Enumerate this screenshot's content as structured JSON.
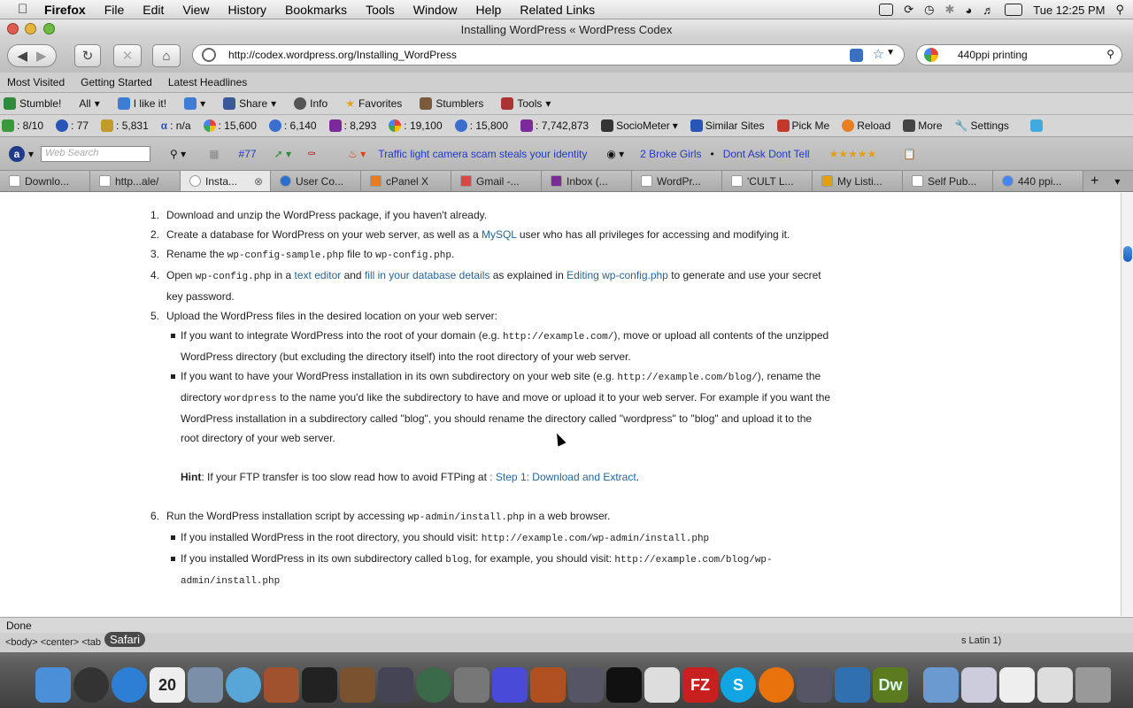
{
  "menubar": {
    "app": "Firefox",
    "items": [
      "File",
      "Edit",
      "View",
      "History",
      "Bookmarks",
      "Tools",
      "Window",
      "Help",
      "Related Links"
    ],
    "clock": "Tue 12:25 PM"
  },
  "window": {
    "title": "Installing WordPress « WordPress Codex"
  },
  "nav": {
    "url": "http://codex.wordpress.org/Installing_WordPress",
    "search_value": "440ppi printing"
  },
  "bookmarks": {
    "items": [
      "Most Visited",
      "Getting Started",
      "Latest Headlines"
    ]
  },
  "stumble": {
    "items": [
      "Stumble!",
      "All",
      "I like it!",
      "Share",
      "Info",
      "Favorites",
      "Stumblers",
      "Tools"
    ]
  },
  "stats": {
    "items": [
      ": 8/10",
      ": 77",
      ": 5,831",
      ": n/a",
      ": 15,600",
      ": 6,140",
      ": 8,293",
      ": 19,100",
      ": 15,800",
      ": 7,742,873",
      "SocioMeter",
      "Similar Sites",
      "Pick Me",
      "Reload",
      "More",
      "Settings"
    ]
  },
  "alexa": {
    "search_placeholder": "Web Search",
    "rank": "#77",
    "headline": "Traffic light camera scam steals your identity",
    "link1": "2 Broke Girls",
    "sep": "•",
    "link2": "Dont Ask Dont Tell",
    "stars": "★★★★★"
  },
  "tabs": [
    "Downlo...",
    "http...ale/",
    "Insta...",
    "User Co...",
    "cPanel X",
    "Gmail -...",
    "Inbox (...",
    "WordPr...",
    "'CULT L...",
    "My Listi...",
    "Self Pub...",
    "440 ppi..."
  ],
  "content": {
    "s1": "Download and unzip the WordPress package, if you haven't already.",
    "s2a": "Create a database for WordPress on your web server, as well as a ",
    "s2link": "MySQL",
    "s2b": " user who has all privileges for accessing and modifying it.",
    "s3a": "Rename the ",
    "s3c1": "wp-config-sample.php",
    "s3b": " file to ",
    "s3c2": "wp-config.php",
    "s3d": ".",
    "s4a": "Open ",
    "s4c": "wp-config.php",
    "s4b": " in a ",
    "s4l1": "text editor",
    "s4and": " and ",
    "s4l2": "fill in your database details",
    "s4c2": " as explained in ",
    "s4l3": "Editing wp-config.php",
    "s4d": " to generate and use your secret key password.",
    "s5": "Upload the WordPress files in the desired location on your web server:",
    "s5b1a": "If you want to integrate WordPress into the root of your domain (e.g. ",
    "s5b1c": "http://example.com/",
    "s5b1b": "), move or upload all contents of the unzipped WordPress directory (but excluding the directory itself) into the root directory of your web server.",
    "s5b2a": "If you want to have your WordPress installation in its own subdirectory on your web site (e.g. ",
    "s5b2c": "http://example.com/blog/",
    "s5b2b": "), rename the directory ",
    "s5b2c2": "wordpress",
    "s5b2d": " to the name you'd like the subdirectory to have and move or upload it to your web server. For example if you want the WordPress installation in a subdirectory called \"blog\", you should rename the directory called \"wordpress\" to \"blog\" and upload it to the root directory of your web server.",
    "hint_label": "Hint",
    "hint_text": ": If your FTP transfer is too slow read how to avoid FTPing at ",
    "hint_link": ": Step 1: Download and Extract",
    "hint_end": ".",
    "s6a": "Run the WordPress installation script by accessing ",
    "s6c": "wp-admin/install.php",
    "s6b": " in a web browser.",
    "s6b1a": "If you installed WordPress in the root directory, you should visit: ",
    "s6b1c": "http://example.com/wp-admin/install.php",
    "s6b2a": "If you installed WordPress in its own subdirectory called ",
    "s6b2c": "blog",
    "s6b2b": ", for example, you should visit: ",
    "s6b2c2": "http://example.com/blog/wp-admin/install.php"
  },
  "status": {
    "text": "Done"
  },
  "devbar": {
    "text": "<body> <center> <tab",
    "tooltip": "Safari",
    "right": "s Latin 1)"
  },
  "colors": {
    "link": "#2a6496",
    "chrome": "#d6d6d6"
  }
}
